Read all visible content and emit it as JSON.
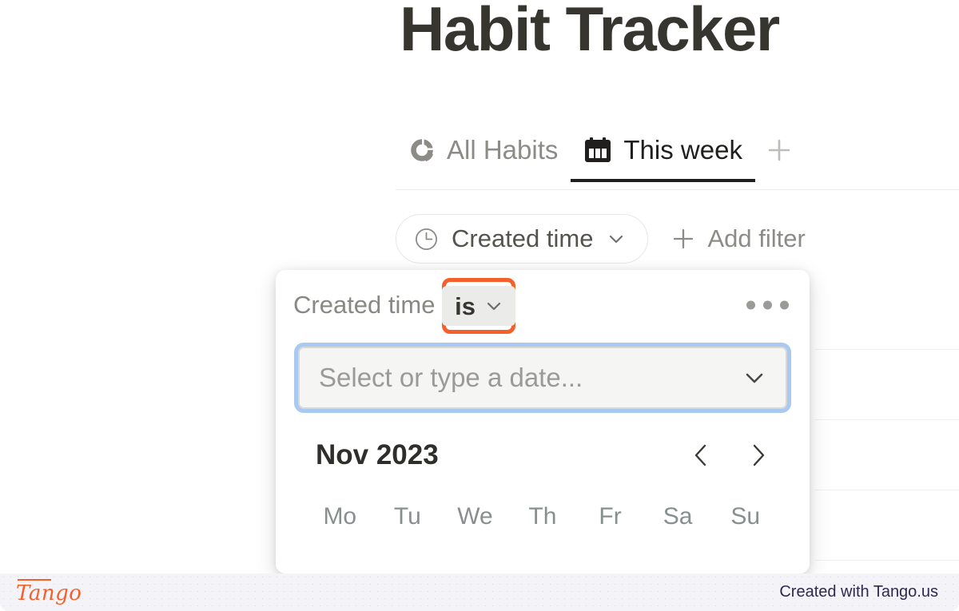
{
  "page": {
    "title": "Habit Tracker"
  },
  "tabs": [
    {
      "label": "All Habits",
      "icon": "donut-chart-icon",
      "active": false
    },
    {
      "label": "This week",
      "icon": "calendar-icon",
      "active": true
    }
  ],
  "tab_add": {
    "icon": "plus-icon"
  },
  "filters": {
    "pill": {
      "label": "Created time",
      "icon": "clock-icon",
      "chevron": "chevron-down-icon"
    },
    "add": {
      "label": "Add filter",
      "icon": "plus-icon"
    }
  },
  "popover": {
    "property_label": "Created time",
    "operator": "is",
    "operator_chevron": "chevron-down-icon",
    "more_icon": "kebab-icon",
    "date_input": {
      "placeholder": "Select or type a date...",
      "value": "",
      "chevron": "chevron-down-icon"
    },
    "calendar": {
      "month_label": "Nov 2023",
      "prev_icon": "chevron-left-icon",
      "next_icon": "chevron-right-icon",
      "weekdays": [
        "Mo",
        "Tu",
        "We",
        "Th",
        "Fr",
        "Sa",
        "Su"
      ]
    }
  },
  "footer": {
    "logo": "Tango",
    "credit": "Created with Tango.us"
  },
  "colors": {
    "highlight": "#f4602b",
    "focus_ring": "#a9c9f0",
    "text_dark": "#37352f",
    "text_muted": "#8d8b87"
  }
}
